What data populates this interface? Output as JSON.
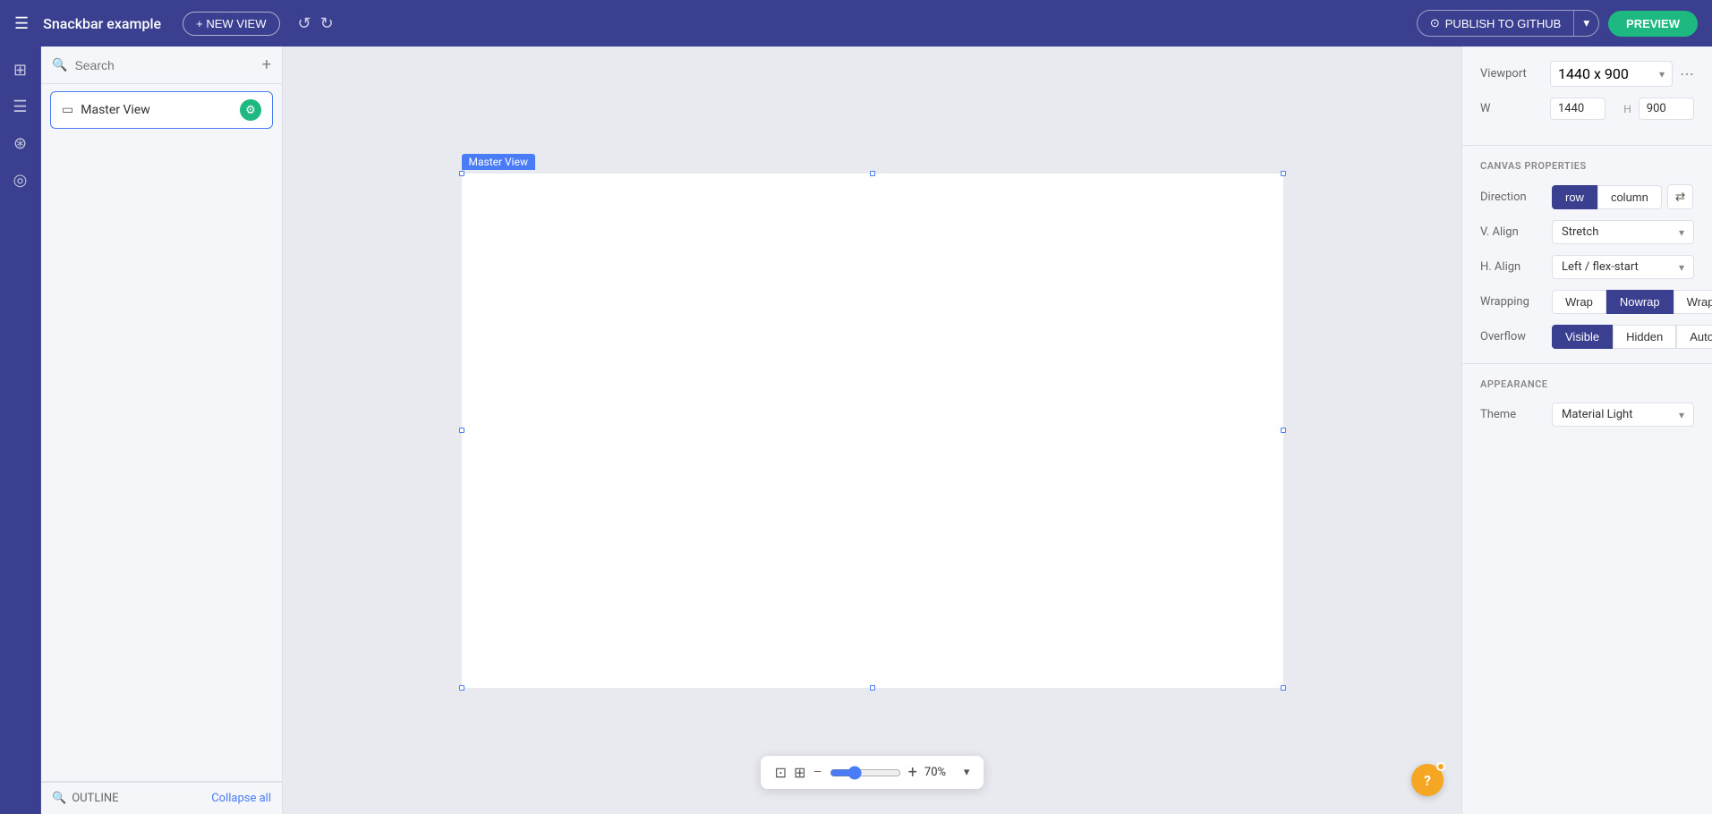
{
  "topbar": {
    "menu_icon": "☰",
    "title": "Snackbar example",
    "new_view_label": "+ NEW VIEW",
    "undo_icon": "↺",
    "redo_icon": "↻",
    "publish_label": "PUBLISH TO GITHUB",
    "github_icon": "⊙",
    "publish_dropdown_icon": "▾",
    "preview_label": "PREVIEW"
  },
  "icon_sidebar": {
    "icons": [
      {
        "name": "grid-icon",
        "symbol": "⊞"
      },
      {
        "name": "layers-icon",
        "symbol": "⊟"
      },
      {
        "name": "database-icon",
        "symbol": "⊛"
      },
      {
        "name": "theme-icon",
        "symbol": "◎"
      }
    ]
  },
  "layers_panel": {
    "search_placeholder": "Search",
    "add_icon": "+",
    "master_view_label": "Master View",
    "outline_label": "OUTLINE",
    "collapse_all_label": "Collapse all"
  },
  "canvas": {
    "frame_label": "Master View",
    "zoom_percent": "70%",
    "zoom_value_num": 70
  },
  "right_panel": {
    "viewport_label": "Viewport",
    "viewport_value": "1440 x 900",
    "more_icon": "⋯",
    "w_label": "W",
    "w_value": "1440",
    "h_label": "H",
    "h_value": "900",
    "canvas_properties_title": "CANVAS PROPERTIES",
    "direction_label": "Direction",
    "row_label": "row",
    "column_label": "column",
    "swap_icon": "⇄",
    "valign_label": "V. Align",
    "valign_value": "Stretch",
    "halign_label": "H. Align",
    "halign_value": "Left / flex-start",
    "wrapping_label": "Wrapping",
    "wrap_label": "Wrap",
    "nowrap_label": "Nowrap",
    "wrapre_label": "WrapRe...",
    "overflow_label": "Overflow",
    "visible_label": "Visible",
    "hidden_label": "Hidden",
    "auto_label": "Auto",
    "appearance_title": "APPEARANCE",
    "theme_label": "Theme",
    "theme_value": "Material Light",
    "theme_chevron": "▾"
  }
}
